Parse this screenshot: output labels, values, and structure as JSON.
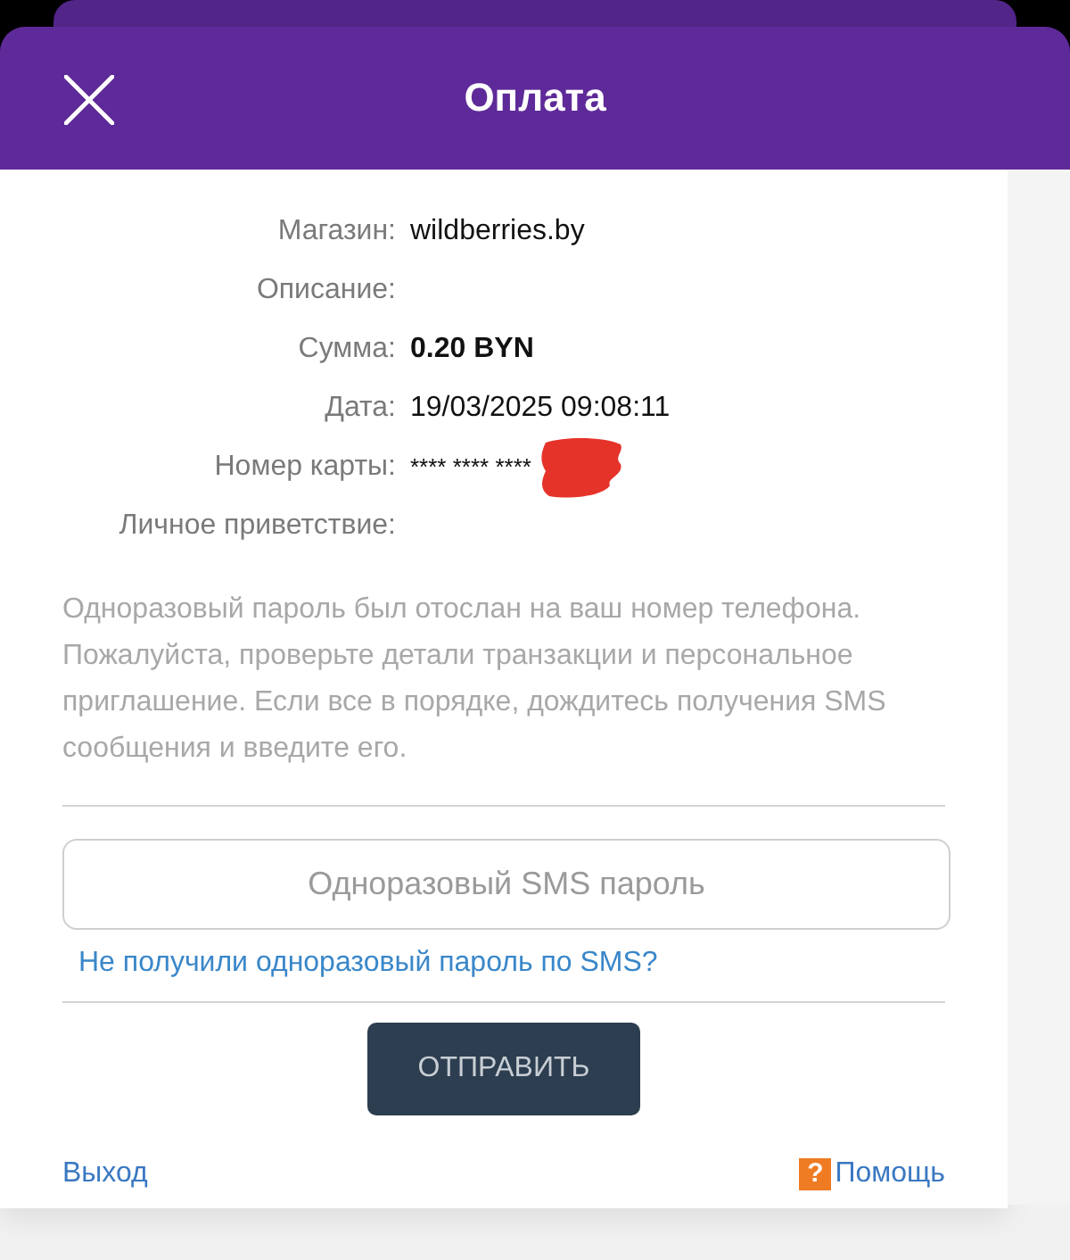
{
  "header": {
    "title": "Оплата"
  },
  "details": [
    {
      "label": "Магазин:",
      "value": "wildberries.by",
      "kind": "plain"
    },
    {
      "label": "Описание:",
      "kind": "plain"
    },
    {
      "label": "Сумма:",
      "value": "0.20 BYN",
      "kind": "bold"
    },
    {
      "label": "Дата:",
      "value": "19/03/2025 09:08:11",
      "kind": "plain"
    },
    {
      "label": "Номер карты:",
      "value": "**** **** ****",
      "kind": "card"
    },
    {
      "label": "Личное приветствие:",
      "kind": "plain"
    }
  ],
  "notice": "Одноразовый пароль был отослан на ваш номер телефона. Пожалуйста, проверьте детали транзакции и персональное приглашение. Если все в порядке, дождитесь получения SMS сообщения и введите его.",
  "otp_field": {
    "placeholder": "Одноразовый SMS пароль"
  },
  "resend_link": "Не получили одноразовый пароль по SMS?",
  "submit_button": "ОТПРАВИТЬ",
  "footer": {
    "exit_link": "Выход",
    "help_icon": "?",
    "help_link": "Помощь"
  }
}
